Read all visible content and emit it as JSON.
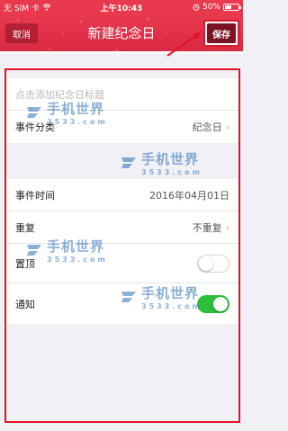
{
  "status_bar": {
    "carrier": "无 SIM 卡",
    "time": "上午10:43",
    "battery_text": "50%",
    "battery_level": 0.5
  },
  "nav": {
    "cancel_label": "取消",
    "title": "新建纪念日",
    "save_label": "保存"
  },
  "form": {
    "title_placeholder": "点击添加纪念日标题",
    "category": {
      "label": "事件分类",
      "value": "纪念日"
    },
    "time": {
      "label": "事件时间",
      "value": "2016年04月01日"
    },
    "repeat": {
      "label": "重复",
      "value": "不重复"
    },
    "pin": {
      "label": "置顶",
      "on": false
    },
    "notify": {
      "label": "通知",
      "on": true
    }
  },
  "watermark": {
    "text": "手机世界",
    "sub": "3533.com"
  },
  "colors": {
    "nav_red": "#e8394f",
    "frame_red": "#e3122a",
    "toggle_green": "#2fbe3b",
    "watermark_blue": "#2d6fb4"
  },
  "icons": [
    "wifi-icon",
    "alarm-icon",
    "battery-icon",
    "chevron-right-icon",
    "arrow-annotation-icon"
  ]
}
